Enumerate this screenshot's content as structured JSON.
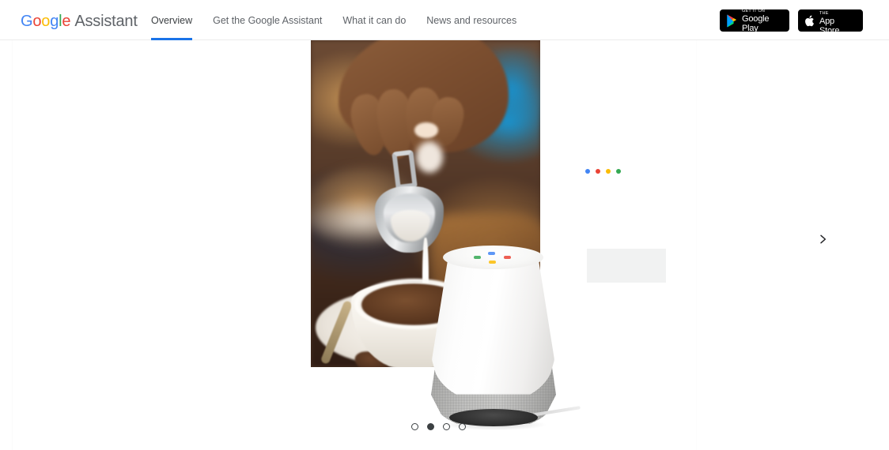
{
  "header": {
    "brand": {
      "google_letters": [
        "G",
        "o",
        "o",
        "g",
        "l",
        "e"
      ],
      "product": "Assistant"
    },
    "nav": [
      {
        "label": "Overview",
        "active": true
      },
      {
        "label": "Get the Google Assistant",
        "active": false
      },
      {
        "label": "What it can do",
        "active": false
      },
      {
        "label": "News and resources",
        "active": false
      }
    ],
    "badges": [
      {
        "icon": "google-play-icon",
        "small": "GET IT ON",
        "big": "Google Play"
      },
      {
        "icon": "apple-logo-icon",
        "small": "Download on the",
        "big": "App Store"
      }
    ],
    "active_underline_color": "#1a73e8",
    "border_color": "#ebebeb"
  },
  "hero": {
    "photo_alt": "hand pouring steamed milk from a steel pitcher into a cup of coffee",
    "device_alt": "Google Home smart speaker",
    "assistant_dot_colors": [
      "#4285F4",
      "#EA4335",
      "#FBBC05",
      "#34A853"
    ],
    "placeholder_color": "#f1f2f2"
  },
  "carousel": {
    "next_icon": "chevron-right-icon",
    "dots": [
      {
        "active": false
      },
      {
        "active": true
      },
      {
        "active": false
      },
      {
        "active": false
      }
    ],
    "active_index": 1,
    "total": 4
  },
  "colors": {
    "google_blue": "#4285F4",
    "google_red": "#EA4335",
    "google_yellow": "#FBBC05",
    "google_green": "#34A853",
    "text_gray": "#5f6368",
    "background": "#ffffff"
  }
}
